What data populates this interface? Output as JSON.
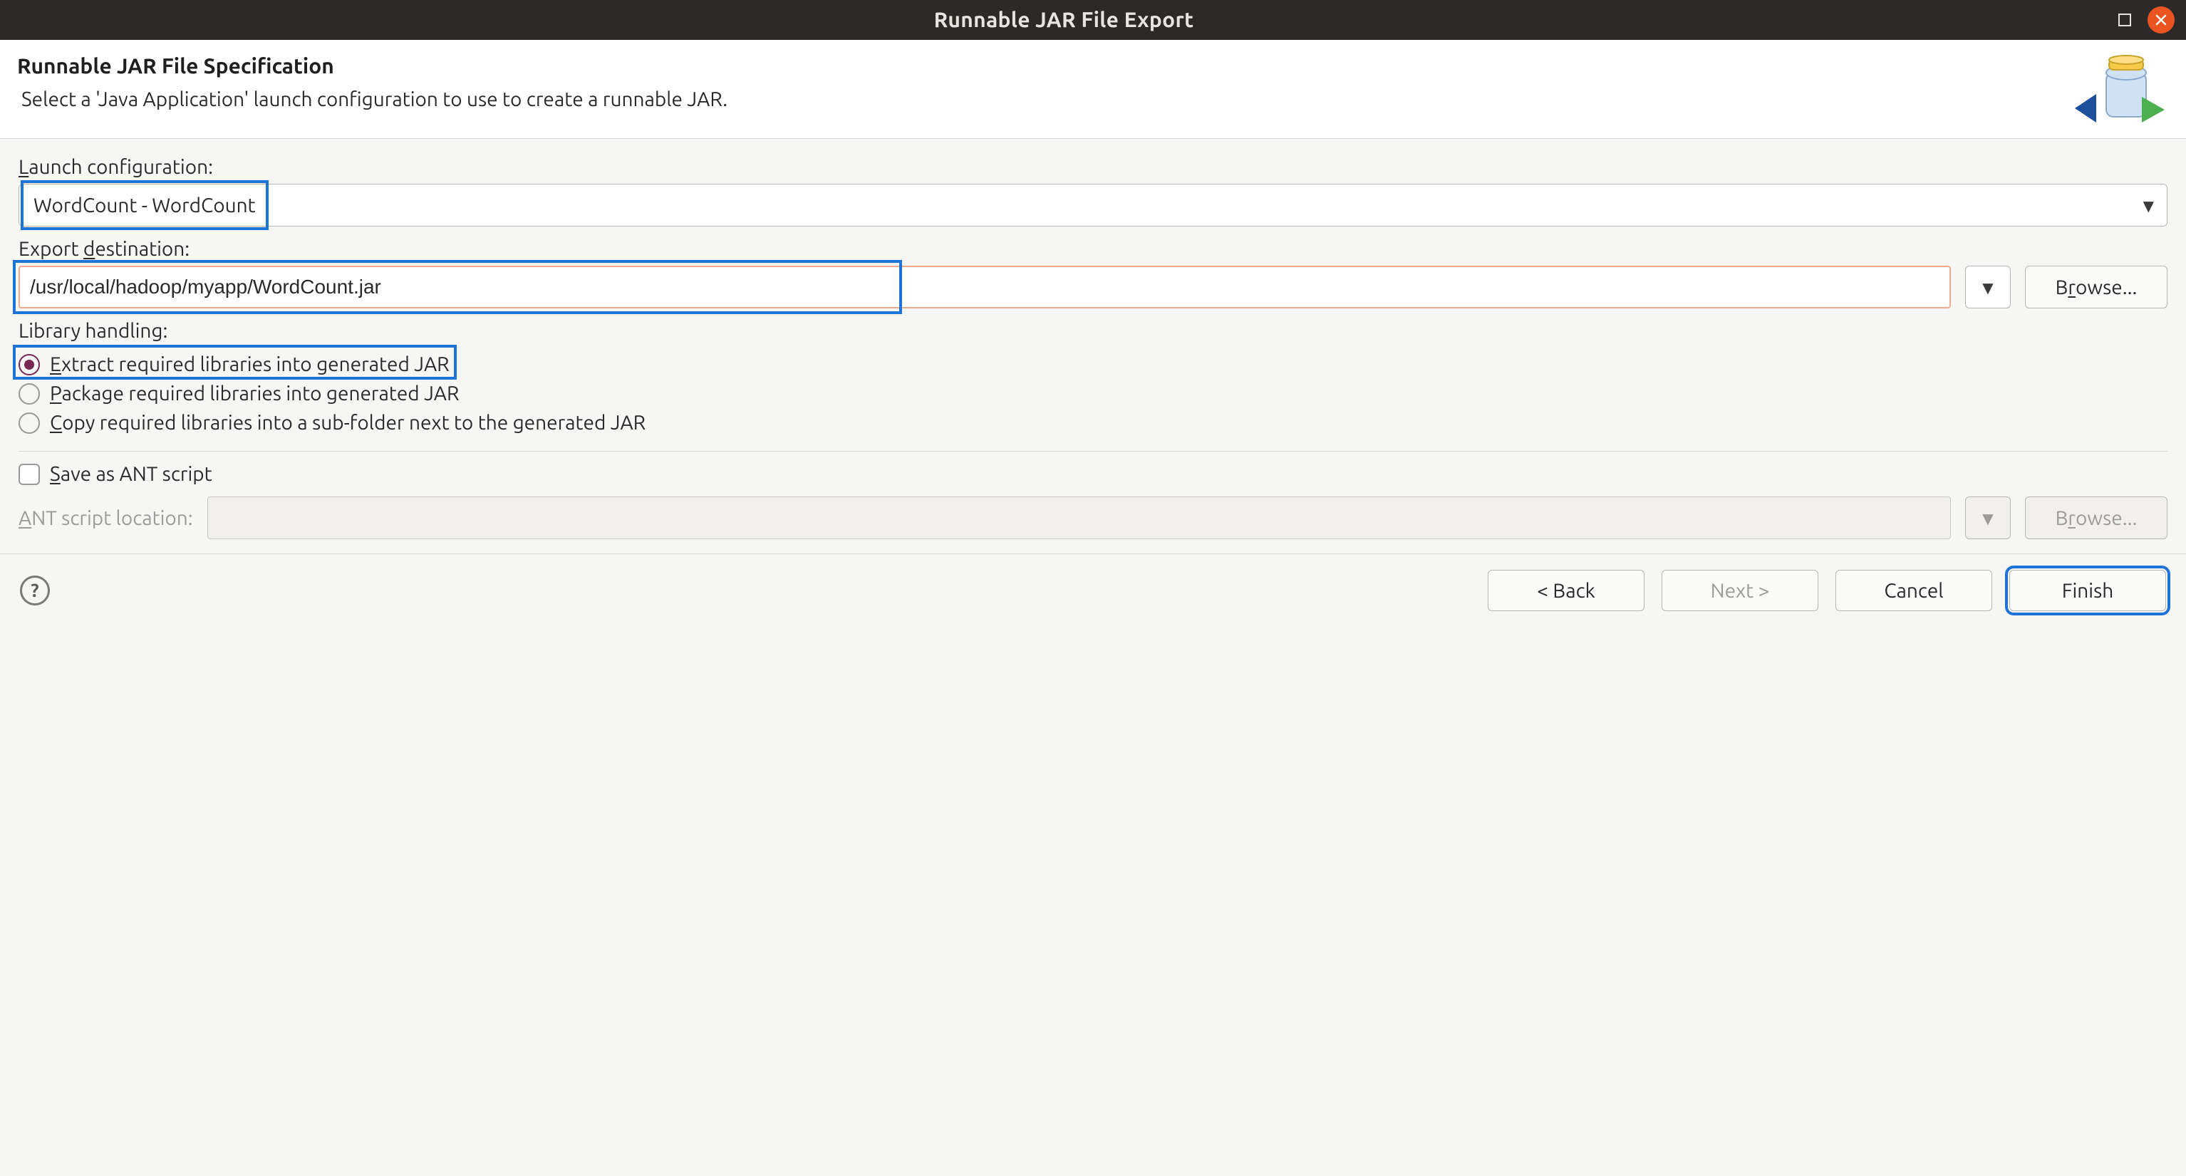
{
  "titlebar": {
    "title": "Runnable JAR File Export"
  },
  "banner": {
    "heading": "Runnable JAR File Specification",
    "subheading": "Select a 'Java Application' launch configuration to use to create a runnable JAR."
  },
  "form": {
    "launch_label_pre": "L",
    "launch_label_post": "aunch configuration:",
    "launch_value": "WordCount - WordCount",
    "export_label_pre": "Export ",
    "export_label_ul": "d",
    "export_label_post": "estination:",
    "export_value": "/usr/local/hadoop/myapp/WordCount.jar",
    "browse_label_pre": "B",
    "browse_label_ul": "r",
    "browse_label_post": "owse...",
    "library_label": "Library handling:",
    "radio1_pre": "E",
    "radio1_post": "xtract required libraries into generated JAR",
    "radio2_pre": "P",
    "radio2_post": "ackage required libraries into generated JAR",
    "radio3_pre": "C",
    "radio3_post": "opy required libraries into a sub-folder next to the generated JAR",
    "save_ant_pre": "S",
    "save_ant_post": "ave as ANT script",
    "ant_loc_label_pre": "A",
    "ant_loc_label_post": "NT script location:",
    "ant_loc_value": "",
    "ant_browse_pre": "B",
    "ant_browse_ul": "r",
    "ant_browse_post": "owse..."
  },
  "footer": {
    "back": "< Back",
    "next": "Next >",
    "cancel": "Cancel",
    "finish": "Finish"
  }
}
